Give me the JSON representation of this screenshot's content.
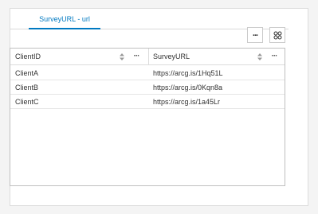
{
  "tabs": [
    {
      "label": "SurveyURL - url"
    }
  ],
  "toolbar": {
    "more_icon": "more-horizontal-icon",
    "grid_icon": "grid-icon"
  },
  "table": {
    "columns": [
      {
        "label": "ClientID"
      },
      {
        "label": "SurveyURL"
      }
    ],
    "rows": [
      {
        "client_id": "ClientA",
        "survey_url": "https://arcg.is/1Hq51L"
      },
      {
        "client_id": "ClientB",
        "survey_url": "https://arcg.is/0Kqn8a"
      },
      {
        "client_id": "ClientC",
        "survey_url": "https://arcg.is/1a45Lr"
      }
    ]
  },
  "colors": {
    "accent": "#0079c1",
    "border": "#dcdcdc"
  }
}
